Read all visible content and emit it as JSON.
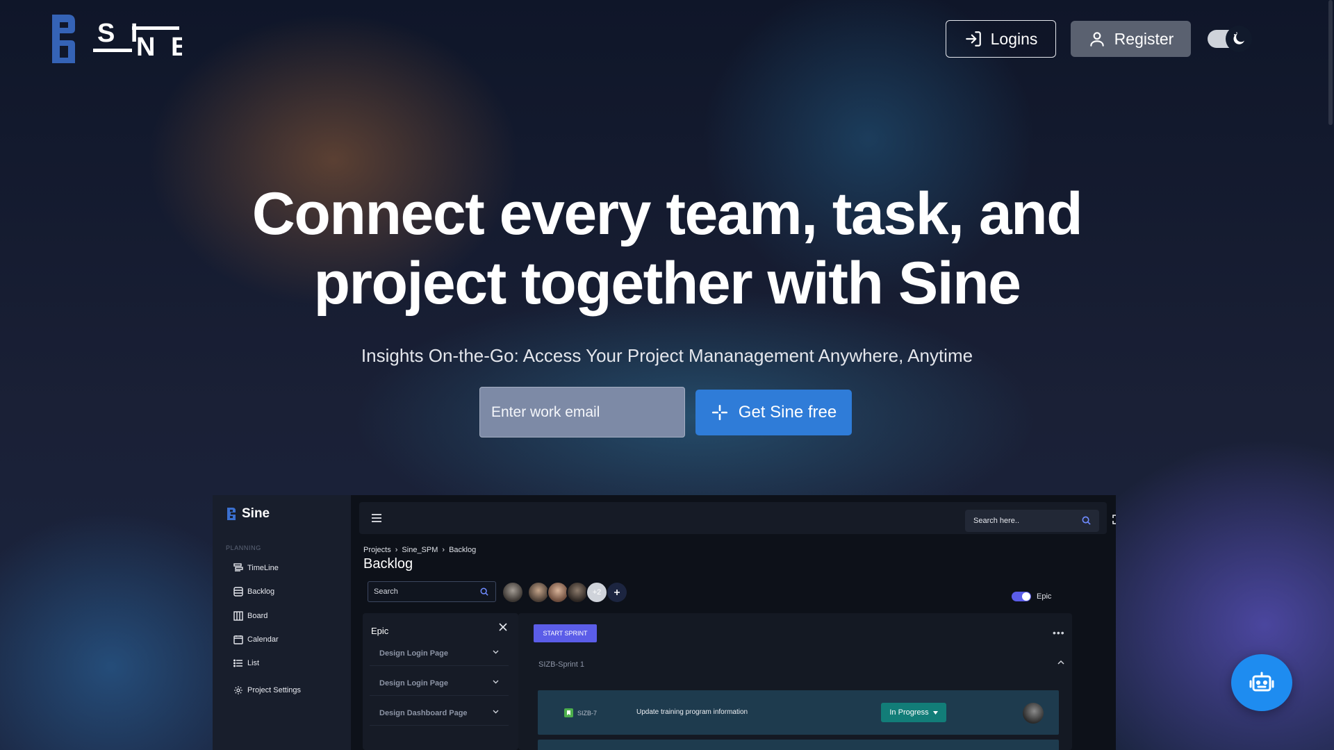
{
  "header": {
    "logo_text": "SINE",
    "login_label": "Logins",
    "register_label": "Register",
    "theme_icon": "moon-icon"
  },
  "hero": {
    "title": "Connect every team, task, and project together with Sine",
    "subtitle": "Insights On-the-Go: Access Your Project Mananagement Anywhere, Anytime",
    "email_placeholder": "Enter work email",
    "cta_label": "Get Sine free"
  },
  "preview": {
    "brand": "Sine",
    "sidebar_section": "PLANNING",
    "nav": [
      {
        "label": "TimeLine",
        "icon": "timeline-icon"
      },
      {
        "label": "Backlog",
        "icon": "backlog-icon"
      },
      {
        "label": "Board",
        "icon": "board-icon"
      },
      {
        "label": "Calendar",
        "icon": "calendar-icon"
      },
      {
        "label": "List",
        "icon": "list-icon"
      },
      {
        "label": "Project Settings",
        "icon": "gear-icon"
      }
    ],
    "topbar_search_placeholder": "Search here..",
    "breadcrumb": [
      "Projects",
      "Sine_SPM",
      "Backlog"
    ],
    "page_title": "Backlog",
    "search_placeholder": "Search",
    "avatar_overflow": "+2",
    "epic_toggle_label": "Epic",
    "epic_panel": {
      "title": "Epic",
      "items": [
        "Design Login Page",
        "Design Login Page",
        "Design Dashboard Page"
      ]
    },
    "sprint": {
      "start_label": "START SPRINT",
      "name": "SIZB-Sprint 1",
      "issues": [
        {
          "id": "SIZB-7",
          "summary": "Update training program information",
          "status": "In Progress"
        }
      ]
    }
  },
  "colors": {
    "accent": "#2f7cd8",
    "status_in_progress": "#127d78",
    "start_sprint": "#5b5de8",
    "bot": "#1e8cf0"
  }
}
